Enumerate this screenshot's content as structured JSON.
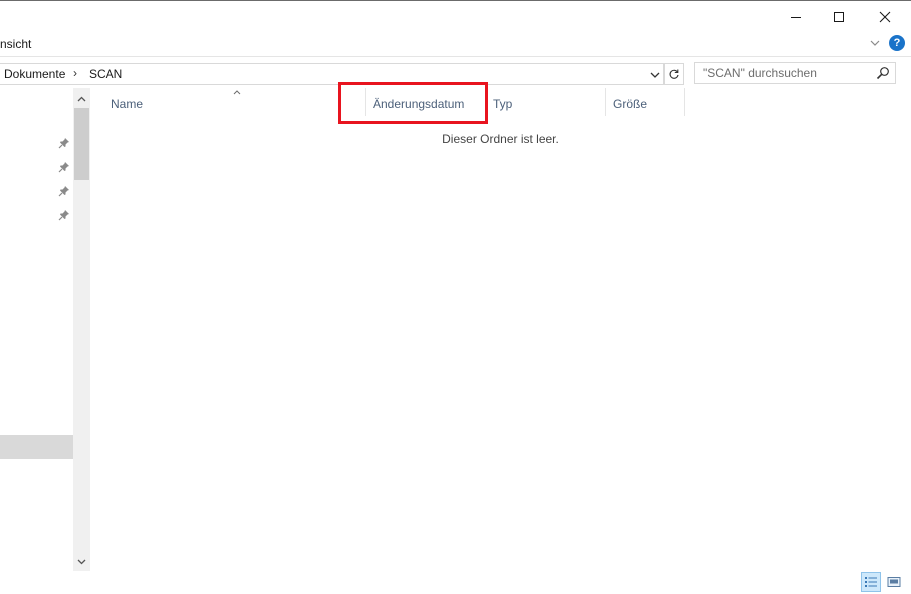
{
  "window": {
    "buttons": {
      "minimize": "minimize",
      "maximize": "maximize",
      "close": "close"
    }
  },
  "ribbon": {
    "visible_tab": "nsicht",
    "help_label": "?"
  },
  "address": {
    "crumbs": [
      "Dokumente",
      "SCAN"
    ],
    "separator": "›"
  },
  "search": {
    "placeholder": "\"SCAN\" durchsuchen"
  },
  "columns": {
    "name": "Name",
    "date": "Änderungsdatum",
    "type": "Typ",
    "size": "Größe"
  },
  "content": {
    "empty_message": "Dieser Ordner ist leer."
  },
  "nav": {
    "pinned_count": 4
  },
  "icons": [
    "minimize-icon",
    "maximize-icon",
    "close-icon",
    "chevron-down-icon",
    "help-icon",
    "refresh-icon",
    "search-icon",
    "pin-icon",
    "sort-arrow-icon",
    "scroll-up-icon",
    "scroll-down-icon",
    "details-view-icon",
    "large-icons-view-icon"
  ],
  "colors": {
    "highlight": "#e8141f",
    "help": "#1a73c9",
    "header_text": "#4c607a",
    "selected_view": "#cde8fb"
  }
}
